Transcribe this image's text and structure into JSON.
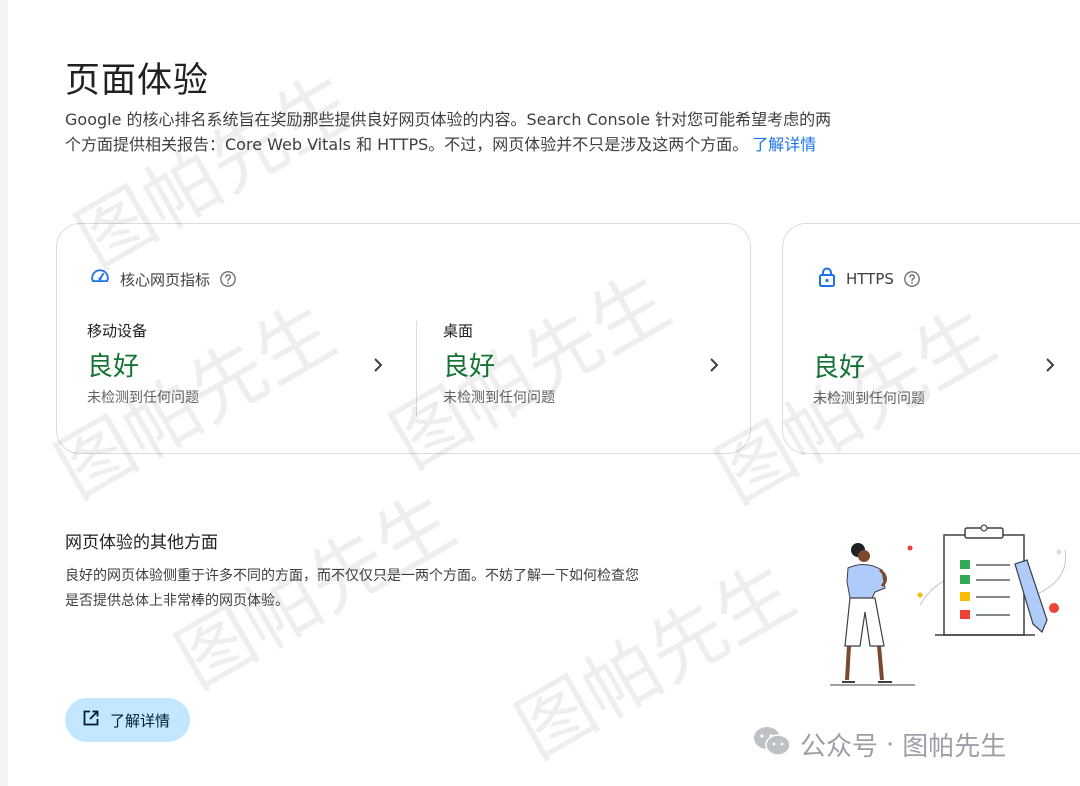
{
  "page": {
    "title": "页面体验",
    "intro_text": "Google 的核心排名系统旨在奖励那些提供良好网页体验的内容。Search Console 针对您可能希望考虑的两个方面提供相关报告：Core Web Vitals 和 HTTPS。不过，网页体验并不只是涉及这两个方面。",
    "intro_link": "了解详情"
  },
  "cwv_card": {
    "title": "核心网页指标",
    "icon": "speedometer-icon",
    "mobile": {
      "label": "移动设备",
      "status": "良好",
      "sub": "未检测到任何问题"
    },
    "desktop": {
      "label": "桌面",
      "status": "良好",
      "sub": "未检测到任何问题"
    }
  },
  "https_card": {
    "title": "HTTPS",
    "icon": "lock-icon",
    "status": "良好",
    "sub": "未检测到任何问题"
  },
  "other": {
    "title": "网页体验的其他方面",
    "desc": "良好的网页体验侧重于许多不同的方面，而不仅仅只是一两个方面。不妨了解一下如何检查您是否提供总体上非常棒的网页体验。",
    "button_label": "了解详情",
    "button_icon": "open-in-new-icon"
  },
  "overlay": {
    "account_prefix": "公众号",
    "separator": "·",
    "account_name": "图帕先生",
    "watermark": "图帕先生"
  },
  "colors": {
    "good": "#137333",
    "accent": "#1a73e8",
    "button_bg": "#c2e7ff"
  }
}
